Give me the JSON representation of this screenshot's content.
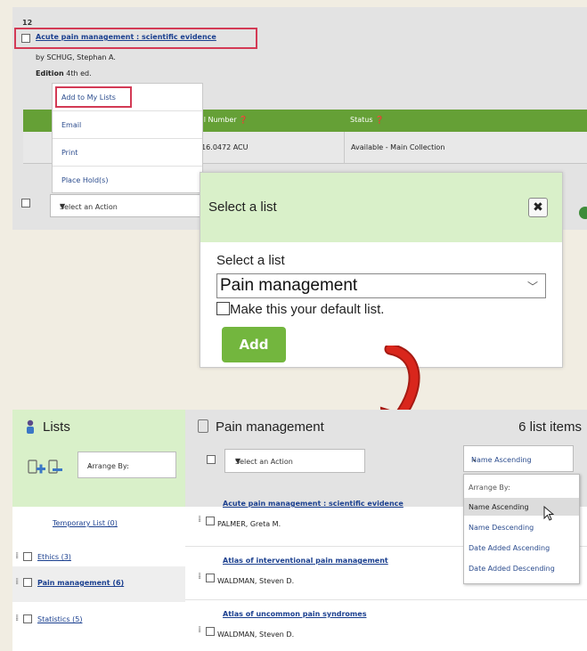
{
  "result": {
    "number": "12",
    "title": "Acute pain management : scientific evidence",
    "by_label": "by",
    "author": "SCHUG, Stephan A.",
    "edition_label": "Edition",
    "edition": "4th ed.",
    "table_headers": [
      "Call Number",
      "Status"
    ],
    "call_number": "616.0472 ACU",
    "status": "Available - Main Collection"
  },
  "action_menu": {
    "items": [
      "Add to My Lists",
      "Email",
      "Print",
      "Place Hold(s)"
    ],
    "select_label": "Select an Action"
  },
  "modal": {
    "title": "Select a list",
    "close": "✖",
    "field_label": "Select a list",
    "selected_list": "Pain management",
    "default_checkbox_label": "Make this your default list.",
    "add_label": "Add"
  },
  "lists_panel": {
    "title": "Lists",
    "arrange_label": "Arrange By:",
    "lists": [
      {
        "label": "Temporary List (0)"
      },
      {
        "label": "Ethics (3)"
      },
      {
        "label": "Pain management (6)"
      },
      {
        "label": "Statistics (5)"
      }
    ]
  },
  "list_view": {
    "name": "Pain management",
    "count": "6 list items",
    "action_select": "Select an Action",
    "sort_selected": "Name Ascending",
    "sort_options": [
      "Arrange By:",
      "Name Ascending",
      "Name Descending",
      "Date Added Ascending",
      "Date Added Descending"
    ],
    "items": [
      {
        "title": "Acute pain management : scientific evidence",
        "author": "PALMER, Greta M."
      },
      {
        "title": "Atlas of interventional pain management",
        "author": "WALDMAN, Steven D."
      },
      {
        "title": "Atlas of uncommon pain syndromes",
        "author": "WALDMAN, Steven D."
      }
    ]
  },
  "colors": {
    "green": "#65a036",
    "light_green": "#d9f0c9",
    "highlight": "#d33a55",
    "arrow": "#d9261c"
  }
}
